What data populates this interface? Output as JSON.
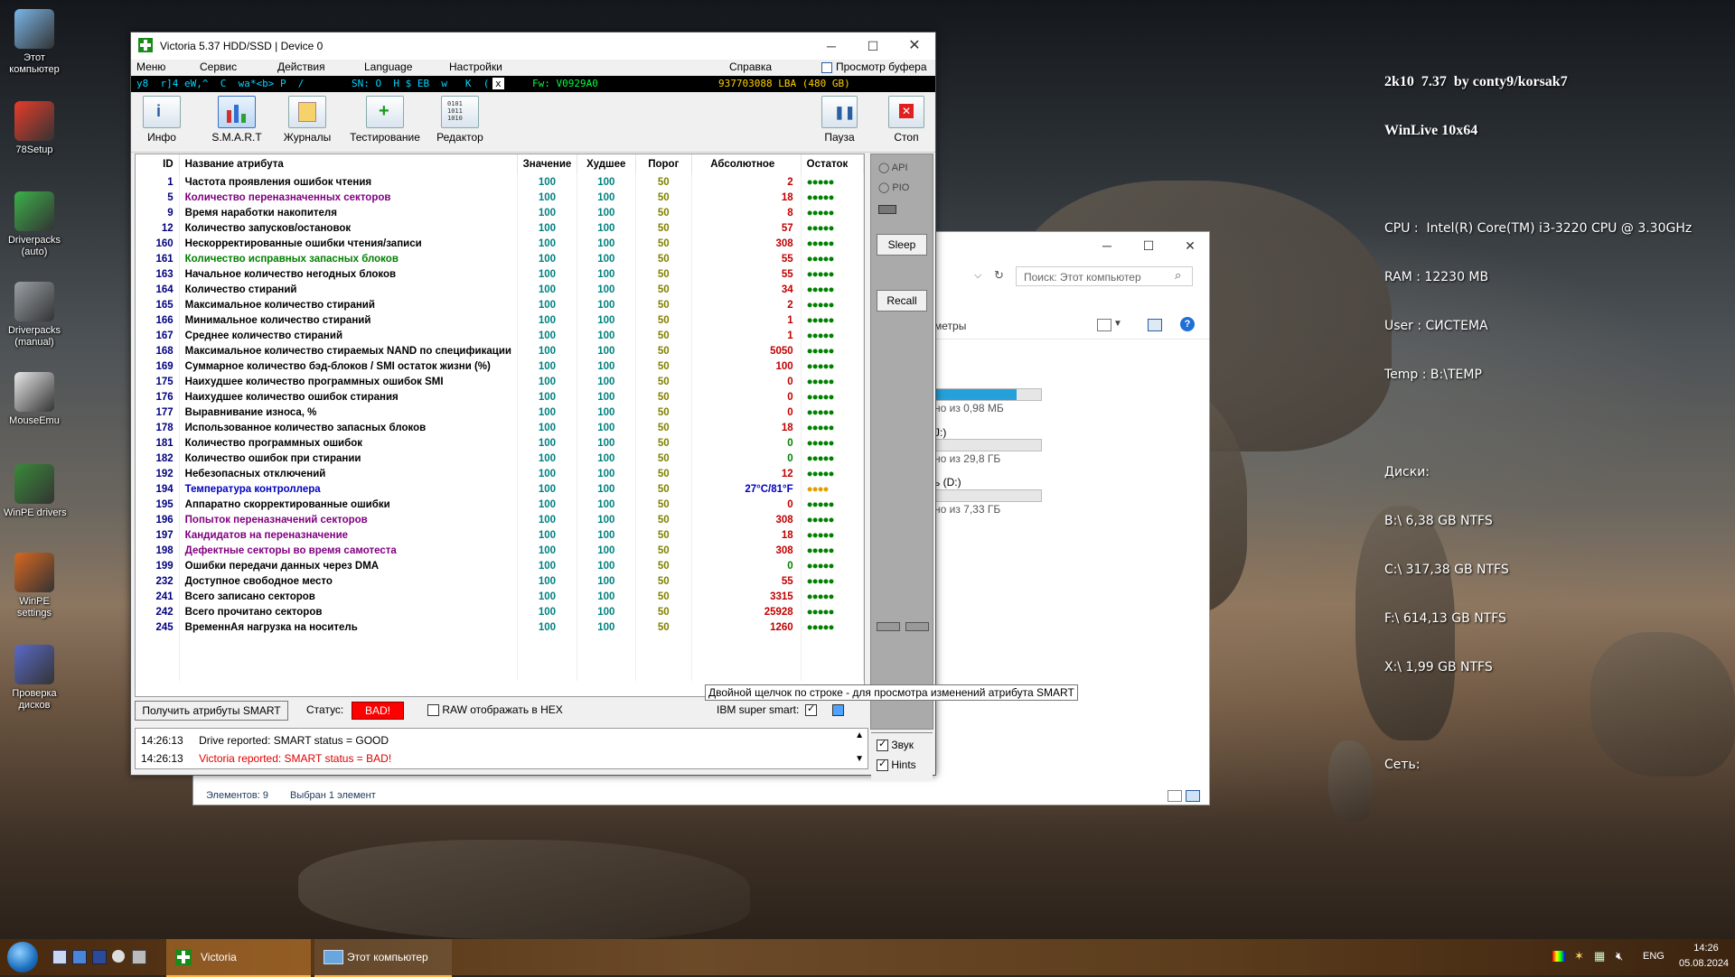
{
  "desktop": {
    "icons": [
      {
        "label": "Этот\nкомпьютер"
      },
      {
        "label": "78Setup"
      },
      {
        "label": "Driverpacks\n(auto)"
      },
      {
        "label": "Driverpacks\n(manual)"
      },
      {
        "label": "MouseEmu"
      },
      {
        "label": "WinPE drivers"
      },
      {
        "label": "WinPE\nsettings"
      },
      {
        "label": "Проверка\nдисков"
      }
    ],
    "info": {
      "line1": "2k10  7.37  by conty9/korsak7",
      "line2": "WinLive 10x64",
      "cpu": "CPU :  Intel(R) Core(TM) i3-3220 CPU @ 3.30GHz",
      "ram": "RAM : 12230 MB",
      "user": "User : СИСТЕМА",
      "temp": "Temp : B:\\TEMP",
      "disks_title": "Диски:",
      "disks": [
        "B:\\ 6,38 GB NTFS",
        "C:\\ 317,38 GB NTFS",
        "F:\\ 614,13 GB NTFS",
        "X:\\ 1,99 GB NTFS"
      ],
      "net": "Сеть:"
    }
  },
  "explorer": {
    "search_placeholder": "Поиск: Этот компьютер",
    "ribbon_fragment": "метры",
    "drives": [
      {
        "label": "",
        "size": "но из 0,98 МБ",
        "fill": 0.8
      },
      {
        "label": "J:)",
        "size": "но из 29,8 ГБ",
        "fill": 0.0
      },
      {
        "label": "ь (D:)",
        "size": "но из 7,33 ГБ",
        "fill": 0.15
      }
    ],
    "status_items": "Элементов: 9",
    "status_selected": "Выбран 1 элемент"
  },
  "victoria": {
    "title": "Victoria 5.37 HDD/SSD | Device 0",
    "menu": [
      "Меню",
      "Сервис",
      "Действия",
      "Language",
      "Настройки",
      "Справка"
    ],
    "buffer_view": "Просмотр буфера",
    "info_strip": {
      "model": "y8  r]4 eW,^  C  wa*<b> P  /",
      "serial": "SN: O  H $ EB  w   K  (",
      "x": "x",
      "fw": "Fw: V0929A0",
      "lba": "937703088 LBA (480 GB)"
    },
    "toolbar": [
      "Инфо",
      "S.M.A.R.T",
      "Журналы",
      "Тестирование",
      "Редактор"
    ],
    "pause": "Пауза",
    "stop": "Стоп",
    "columns": [
      "ID",
      "Название атрибута",
      "Значение",
      "Худшее",
      "Порог",
      "Абсолютное",
      "Остаток"
    ],
    "rows": [
      {
        "id": "1",
        "name": "Частота проявления ошибок чтения",
        "val": "100",
        "worst": "100",
        "thr": "50",
        "raw": "2",
        "rem": "●●●●●",
        "color": "#000000"
      },
      {
        "id": "5",
        "name": "Количество переназначенных секторов",
        "val": "100",
        "worst": "100",
        "thr": "50",
        "raw": "18",
        "rem": "●●●●●",
        "color": "#800080"
      },
      {
        "id": "9",
        "name": "Время наработки накопителя",
        "val": "100",
        "worst": "100",
        "thr": "50",
        "raw": "8",
        "rem": "●●●●●",
        "color": "#000000"
      },
      {
        "id": "12",
        "name": "Количество запусков/остановок",
        "val": "100",
        "worst": "100",
        "thr": "50",
        "raw": "57",
        "rem": "●●●●●",
        "color": "#000000"
      },
      {
        "id": "160",
        "name": "Нескорректированные ошибки чтения/записи",
        "val": "100",
        "worst": "100",
        "thr": "50",
        "raw": "308",
        "rem": "●●●●●",
        "color": "#000000"
      },
      {
        "id": "161",
        "name": "Количество исправных запасных блоков",
        "val": "100",
        "worst": "100",
        "thr": "50",
        "raw": "55",
        "rem": "●●●●●",
        "color": "#008000"
      },
      {
        "id": "163",
        "name": "Начальное количество негодных блоков",
        "val": "100",
        "worst": "100",
        "thr": "50",
        "raw": "55",
        "rem": "●●●●●",
        "color": "#000000"
      },
      {
        "id": "164",
        "name": "Количество стираний",
        "val": "100",
        "worst": "100",
        "thr": "50",
        "raw": "34",
        "rem": "●●●●●",
        "color": "#000000"
      },
      {
        "id": "165",
        "name": "Максимальное количество стираний",
        "val": "100",
        "worst": "100",
        "thr": "50",
        "raw": "2",
        "rem": "●●●●●",
        "color": "#000000"
      },
      {
        "id": "166",
        "name": "Минимальное количество стираний",
        "val": "100",
        "worst": "100",
        "thr": "50",
        "raw": "1",
        "rem": "●●●●●",
        "color": "#000000"
      },
      {
        "id": "167",
        "name": "Среднее количество стираний",
        "val": "100",
        "worst": "100",
        "thr": "50",
        "raw": "1",
        "rem": "●●●●●",
        "color": "#000000"
      },
      {
        "id": "168",
        "name": "Максимальное количество стираемых NAND по спецификации",
        "val": "100",
        "worst": "100",
        "thr": "50",
        "raw": "5050",
        "rem": "●●●●●",
        "color": "#000000"
      },
      {
        "id": "169",
        "name": "Суммарное количество бэд-блоков / SMI остаток жизни (%)",
        "val": "100",
        "worst": "100",
        "thr": "50",
        "raw": "100",
        "rem": "●●●●●",
        "color": "#000000"
      },
      {
        "id": "175",
        "name": "Наихудшее количество программных ошибок SMI",
        "val": "100",
        "worst": "100",
        "thr": "50",
        "raw": "0",
        "rem": "●●●●●",
        "color": "#000000"
      },
      {
        "id": "176",
        "name": "Наихудшее количество ошибок стирания",
        "val": "100",
        "worst": "100",
        "thr": "50",
        "raw": "0",
        "rem": "●●●●●",
        "color": "#000000"
      },
      {
        "id": "177",
        "name": "Выравнивание износа, %",
        "val": "100",
        "worst": "100",
        "thr": "50",
        "raw": "0",
        "rem": "●●●●●",
        "color": "#000000"
      },
      {
        "id": "178",
        "name": "Использованное количество запасных блоков",
        "val": "100",
        "worst": "100",
        "thr": "50",
        "raw": "18",
        "rem": "●●●●●",
        "color": "#000000"
      },
      {
        "id": "181",
        "name": "Количество программных ошибок",
        "val": "100",
        "worst": "100",
        "thr": "50",
        "raw": "0",
        "rem": "●●●●●",
        "color": "#000000",
        "rawcolor": "#008000"
      },
      {
        "id": "182",
        "name": "Количество ошибок при стирании",
        "val": "100",
        "worst": "100",
        "thr": "50",
        "raw": "0",
        "rem": "●●●●●",
        "color": "#000000",
        "rawcolor": "#008000"
      },
      {
        "id": "192",
        "name": "Небезопасных отключений",
        "val": "100",
        "worst": "100",
        "thr": "50",
        "raw": "12",
        "rem": "●●●●●",
        "color": "#000000"
      },
      {
        "id": "194",
        "name": "Температура контроллера",
        "val": "100",
        "worst": "100",
        "thr": "50",
        "raw": "27°C/81°F",
        "rem": "●●●●",
        "color": "#0000c0",
        "rawcolor": "#0000c0",
        "remcolor": "#e0a000"
      },
      {
        "id": "195",
        "name": "Аппаратно скорректированные ошибки",
        "val": "100",
        "worst": "100",
        "thr": "50",
        "raw": "0",
        "rem": "●●●●●",
        "color": "#000000"
      },
      {
        "id": "196",
        "name": "Попыток переназначений секторов",
        "val": "100",
        "worst": "100",
        "thr": "50",
        "raw": "308",
        "rem": "●●●●●",
        "color": "#800080"
      },
      {
        "id": "197",
        "name": "Кандидатов на переназначение",
        "val": "100",
        "worst": "100",
        "thr": "50",
        "raw": "18",
        "rem": "●●●●●",
        "color": "#800080"
      },
      {
        "id": "198",
        "name": "Дефектные секторы во время самотеста",
        "val": "100",
        "worst": "100",
        "thr": "50",
        "raw": "308",
        "rem": "●●●●●",
        "color": "#800080"
      },
      {
        "id": "199",
        "name": "Ошибки передачи данных через DMA",
        "val": "100",
        "worst": "100",
        "thr": "50",
        "raw": "0",
        "rem": "●●●●●",
        "color": "#000000",
        "rawcolor": "#008000"
      },
      {
        "id": "232",
        "name": "Доступное свободное место",
        "val": "100",
        "worst": "100",
        "thr": "50",
        "raw": "55",
        "rem": "●●●●●",
        "color": "#000000"
      },
      {
        "id": "241",
        "name": "Всего записано секторов",
        "val": "100",
        "worst": "100",
        "thr": "50",
        "raw": "3315",
        "rem": "●●●●●",
        "color": "#000000"
      },
      {
        "id": "242",
        "name": "Всего прочитано секторов",
        "val": "100",
        "worst": "100",
        "thr": "50",
        "raw": "25928",
        "rem": "●●●●●",
        "color": "#000000"
      },
      {
        "id": "245",
        "name": "ВременнАя нагрузка на носитель",
        "val": "100",
        "worst": "100",
        "thr": "50",
        "raw": "1260",
        "rem": "●●●●●",
        "color": "#000000"
      }
    ],
    "side": {
      "api": "API",
      "pio": "PIO",
      "sleep": "Sleep",
      "recall": "Recall",
      "sound": "Звук",
      "hints": "Hints"
    },
    "get_smart": "Получить атрибуты SMART",
    "status_label": "Статус:",
    "status_value": "BAD!",
    "raw_hex": "RAW отображать в HEX",
    "ibm": "IBM super smart:",
    "tooltip": "Двойной щелчок по строке - для просмотра изменений атрибута SMART",
    "log": [
      {
        "time": "14:26:13",
        "text": "Drive reported: SMART status = GOOD",
        "color": "#000000"
      },
      {
        "time": "14:26:13",
        "text": "Victoria reported: SMART status = BAD!",
        "color": "#e00000"
      }
    ]
  },
  "taskbar": {
    "items": [
      "Victoria",
      "Этот компьютер"
    ],
    "lang": "ENG",
    "time": "14:26",
    "date": "05.08.2024"
  }
}
